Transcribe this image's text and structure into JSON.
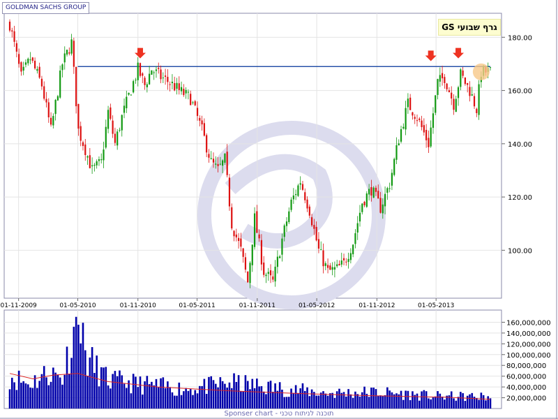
{
  "legend_label": "GOLDMAN SACHS GROUP",
  "chart_title": "GS גרף שבועי",
  "footer_text": "Sponser chart - תוכנה לניתוח טכני",
  "colors": {
    "up": "#119911",
    "down": "#dd1111",
    "volume": "#0000aa",
    "volume_ma": "#dd2222",
    "resistance": "#003399",
    "marker": "#ee3322",
    "highlight": "#f8c888",
    "watermark": "#d8d8ee"
  },
  "chart_data": [
    {
      "type": "candlestick",
      "title": "GS גרף שבועי",
      "x_tick_labels": [
        "01-11-2009",
        "01-05-2010",
        "01-11-2010",
        "01-05-2011",
        "01-11-2011",
        "01-05-2012",
        "01-11-2012",
        "01-05-2013"
      ],
      "y_tick_labels": [
        "100.00",
        "120.00",
        "140.00",
        "160.00",
        "180.00"
      ],
      "ylim": [
        82,
        189
      ],
      "x_range": [
        "2009-10-05",
        "2013-10-14"
      ],
      "grid": true,
      "resistance_line": {
        "value": 169,
        "from": "2010-05-01",
        "to": "2013-10-14"
      },
      "markers": [
        {
          "date": "2010-11-08",
          "value": 171,
          "kind": "down-arrow"
        },
        {
          "date": "2013-04-15",
          "value": 170,
          "kind": "down-arrow"
        },
        {
          "date": "2013-07-08",
          "value": 171,
          "kind": "down-arrow"
        }
      ],
      "highlight": {
        "date": "2013-09-16",
        "value": 167
      },
      "series": [
        {
          "price_points": [
            [
              "2009-10-05",
              185
            ],
            [
              "2009-11-09",
              165
            ],
            [
              "2009-12-07",
              172
            ],
            [
              "2010-01-11",
              162
            ],
            [
              "2010-02-08",
              145
            ],
            [
              "2010-03-15",
              170
            ],
            [
              "2010-04-12",
              178
            ],
            [
              "2010-05-03",
              145
            ],
            [
              "2010-05-24",
              138
            ],
            [
              "2010-06-14",
              130
            ],
            [
              "2010-07-12",
              133
            ],
            [
              "2010-08-02",
              152
            ],
            [
              "2010-08-23",
              140
            ],
            [
              "2010-09-13",
              150
            ],
            [
              "2010-10-04",
              158
            ],
            [
              "2010-11-01",
              168
            ],
            [
              "2010-11-22",
              162
            ],
            [
              "2010-12-13",
              168
            ],
            [
              "2011-01-10",
              165
            ],
            [
              "2011-02-07",
              163
            ],
            [
              "2011-03-07",
              160
            ],
            [
              "2011-04-11",
              157
            ],
            [
              "2011-05-16",
              145
            ],
            [
              "2011-06-13",
              133
            ],
            [
              "2011-07-04",
              130
            ],
            [
              "2011-07-25",
              134
            ],
            [
              "2011-08-15",
              110
            ],
            [
              "2011-09-12",
              100
            ],
            [
              "2011-10-03",
              88
            ],
            [
              "2011-10-24",
              112
            ],
            [
              "2011-11-21",
              92
            ],
            [
              "2011-12-19",
              88
            ],
            [
              "2012-01-16",
              104
            ],
            [
              "2012-02-13",
              118
            ],
            [
              "2012-03-12",
              126
            ],
            [
              "2012-04-09",
              115
            ],
            [
              "2012-05-07",
              100
            ],
            [
              "2012-06-04",
              92
            ],
            [
              "2012-07-02",
              93
            ],
            [
              "2012-07-23",
              95
            ],
            [
              "2012-08-20",
              103
            ],
            [
              "2012-09-17",
              118
            ],
            [
              "2012-10-15",
              123
            ],
            [
              "2012-11-12",
              116
            ],
            [
              "2012-12-10",
              125
            ],
            [
              "2013-01-07",
              142
            ],
            [
              "2013-02-04",
              155
            ],
            [
              "2013-03-04",
              150
            ],
            [
              "2013-04-08",
              140
            ],
            [
              "2013-05-06",
              163
            ],
            [
              "2013-05-27",
              165
            ],
            [
              "2013-06-24",
              155
            ],
            [
              "2013-07-15",
              166
            ],
            [
              "2013-08-12",
              160
            ],
            [
              "2013-09-02",
              153
            ],
            [
              "2013-09-16",
              167
            ]
          ]
        }
      ]
    },
    {
      "type": "bar",
      "title": "",
      "y_tick_labels": [
        "20,000,000",
        "40,000,000",
        "60,000,000",
        "80,000,000",
        "100,000,000",
        "120,000,000",
        "140,000,000",
        "160,000,000"
      ],
      "ylim": [
        0,
        180000000
      ],
      "x_range": [
        "2009-10-05",
        "2013-10-14"
      ],
      "series": [
        {
          "volume_points": [
            [
              "2009-10-05",
              65000000
            ],
            [
              "2009-12-01",
              48000000
            ],
            [
              "2010-02-01",
              70000000
            ],
            [
              "2010-03-15",
              60000000
            ],
            [
              "2010-04-26",
              170000000
            ],
            [
              "2010-06-01",
              95000000
            ],
            [
              "2010-08-01",
              55000000
            ],
            [
              "2010-11-01",
              48000000
            ],
            [
              "2011-04-01",
              38000000
            ],
            [
              "2011-08-15",
              50000000
            ],
            [
              "2011-12-01",
              42000000
            ],
            [
              "2012-06-01",
              30000000
            ],
            [
              "2012-11-01",
              32000000
            ],
            [
              "2013-05-01",
              24000000
            ],
            [
              "2013-09-16",
              23000000
            ]
          ]
        },
        {
          "ma_points": [
            [
              "2009-10-05",
              65000000
            ],
            [
              "2009-12-15",
              55000000
            ],
            [
              "2010-02-15",
              62000000
            ],
            [
              "2010-05-01",
              65000000
            ],
            [
              "2010-08-01",
              50000000
            ],
            [
              "2011-01-01",
              40000000
            ],
            [
              "2011-08-01",
              33000000
            ],
            [
              "2012-03-01",
              28000000
            ],
            [
              "2012-10-01",
              24000000
            ],
            [
              "2013-06-01",
              21000000
            ],
            [
              "2013-10-14",
              17000000
            ]
          ]
        }
      ]
    }
  ]
}
